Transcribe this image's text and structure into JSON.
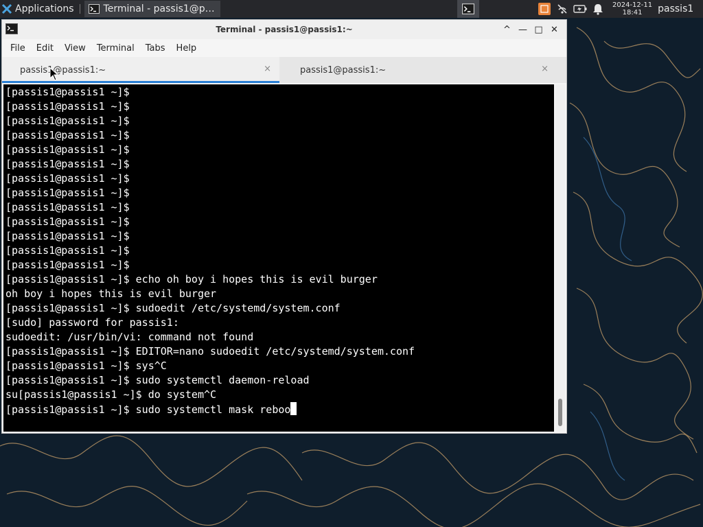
{
  "panel": {
    "apps_label": "Applications",
    "taskbar_label": "Terminal - passis1@p…",
    "clock_date": "2024-12-11",
    "clock_time": "18:41",
    "user": "passis1",
    "icons": {
      "apps": "xfce-mouse-icon",
      "terminal": "terminal-icon",
      "workspace": "workspace-icon",
      "tray": [
        "app-indicator-icon",
        "network-off-icon",
        "battery-icon",
        "notification-bell-icon"
      ]
    }
  },
  "window": {
    "title": "Terminal - passis1@passis1:~",
    "controls": [
      "^",
      "—",
      "□",
      "✕"
    ],
    "menu": [
      "File",
      "Edit",
      "View",
      "Terminal",
      "Tabs",
      "Help"
    ],
    "tabs": [
      {
        "label": "passis1@passis1:~",
        "active": true
      },
      {
        "label": "passis1@passis1:~",
        "active": false
      }
    ],
    "tab_close": "×"
  },
  "terminal": {
    "lines": [
      "[passis1@passis1 ~]$",
      "[passis1@passis1 ~]$",
      "[passis1@passis1 ~]$",
      "[passis1@passis1 ~]$",
      "[passis1@passis1 ~]$",
      "[passis1@passis1 ~]$",
      "[passis1@passis1 ~]$",
      "[passis1@passis1 ~]$",
      "[passis1@passis1 ~]$",
      "[passis1@passis1 ~]$",
      "[passis1@passis1 ~]$",
      "[passis1@passis1 ~]$",
      "[passis1@passis1 ~]$",
      "[passis1@passis1 ~]$ echo oh boy i hopes this is evil burger",
      "oh boy i hopes this is evil burger",
      "[passis1@passis1 ~]$ sudoedit /etc/systemd/system.conf",
      "[sudo] password for passis1:",
      "sudoedit: /usr/bin/vi: command not found",
      "[passis1@passis1 ~]$ EDITOR=nano sudoedit /etc/systemd/system.conf",
      "[passis1@passis1 ~]$ sys^C",
      "[passis1@passis1 ~]$ sudo systemctl daemon-reload",
      "su[passis1@passis1 ~]$ do system^C"
    ],
    "current_line": "[passis1@passis1 ~]$ sudo systemctl mask reboo"
  },
  "colors": {
    "panel_bg": "#26272b",
    "accent_tab": "#2a7fd4",
    "terminal_bg": "#000000",
    "terminal_fg": "#ffffff",
    "wallpaper_bg": "#0f1e2c",
    "wallpaper_lines": "#c9a06a"
  }
}
